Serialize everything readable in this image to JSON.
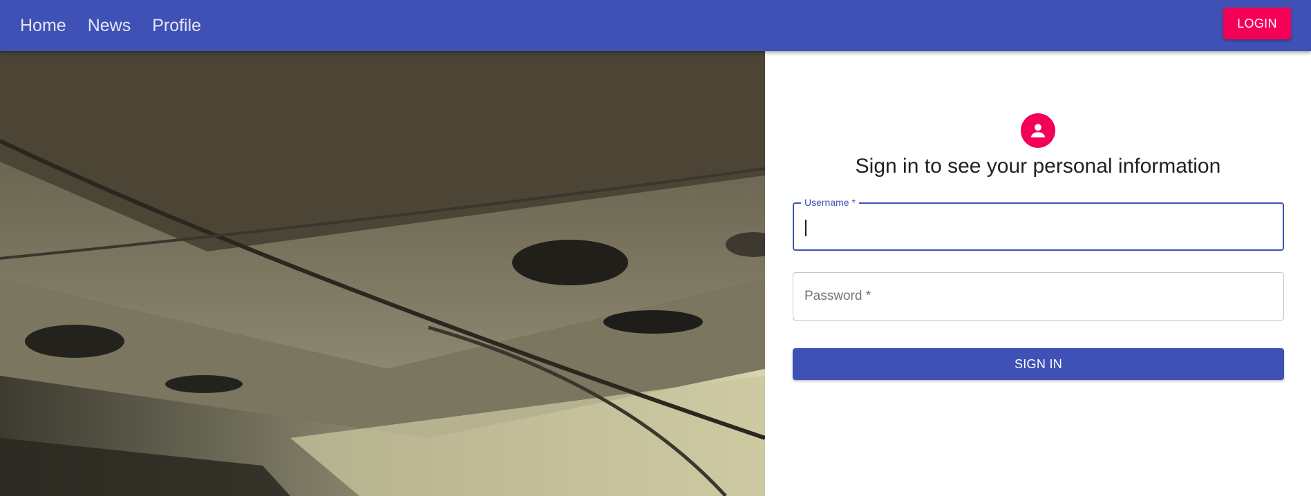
{
  "nav": {
    "items": [
      {
        "label": "Home"
      },
      {
        "label": "News"
      },
      {
        "label": "Profile"
      }
    ],
    "login_label": "LOGIN"
  },
  "colors": {
    "primary": "#3f51b5",
    "secondary": "#f50057"
  },
  "hero": {
    "icon": "concrete-ceiling-photo"
  },
  "form": {
    "avatar_icon": "person-icon",
    "heading": "Sign in to see your personal information",
    "username": {
      "label": "Username *",
      "value": "",
      "focused": true
    },
    "password": {
      "label": "Password *",
      "value": ""
    },
    "submit_label": "SIGN IN"
  }
}
